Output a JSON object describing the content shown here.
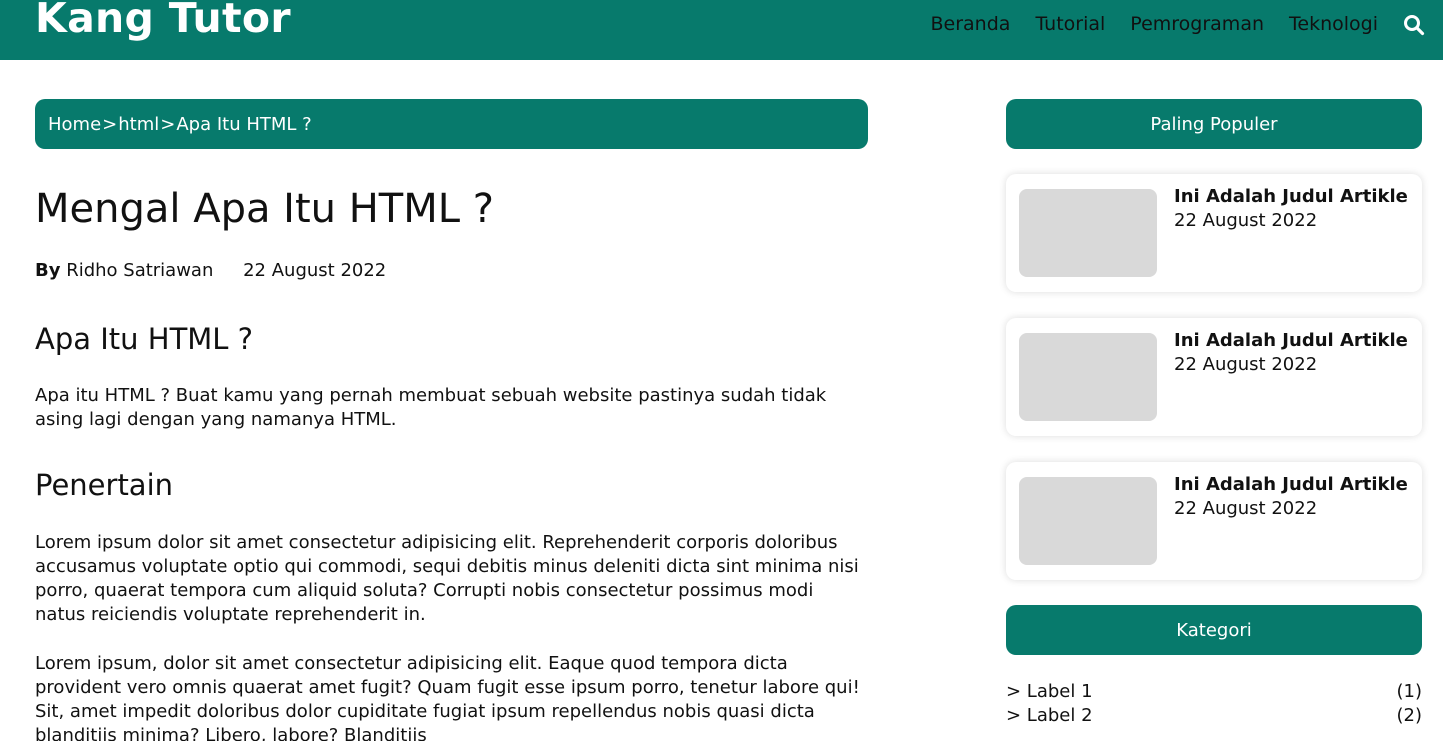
{
  "header": {
    "brand": "Kang Tutor",
    "nav": [
      "Beranda",
      "Tutorial",
      "Pemrograman",
      "Teknologi"
    ],
    "search_icon": "search-icon"
  },
  "breadcrumb": {
    "items": [
      "Home",
      "html",
      "Apa Itu HTML ?"
    ],
    "separator": ">"
  },
  "article": {
    "title": "Mengal Apa Itu HTML ?",
    "by_label": "By",
    "author": "Ridho Satriawan",
    "date": "22 August 2022",
    "section1_heading": "Apa Itu HTML ?",
    "section1_text": "Apa itu HTML ? Buat kamu yang pernah membuat sebuah website pastinya sudah tidak asing lagi dengan yang namanya HTML.",
    "section2_heading": "Penertain",
    "section2_text1": "Lorem ipsum dolor sit amet consectetur adipisicing elit. Reprehenderit corporis doloribus accusamus voluptate optio qui commodi, sequi debitis minus deleniti dicta sint minima nisi porro, quaerat tempora cum aliquid soluta? Corrupti nobis consectetur possimus modi natus reiciendis voluptate reprehenderit in.",
    "section2_text2": "Lorem ipsum, dolor sit amet consectetur adipisicing elit. Eaque quod tempora dicta provident vero omnis quaerat amet fugit? Quam fugit esse ipsum porro, tenetur labore qui! Sit, amet impedit doloribus dolor cupiditate fugiat ipsum repellendus nobis quasi dicta blanditiis minima? Libero, labore? Blanditiis"
  },
  "sidebar": {
    "popular_heading": "Paling Populer",
    "popular": [
      {
        "title": "Ini Adalah Judul Artikle",
        "date": "22 August 2022"
      },
      {
        "title": "Ini Adalah Judul Artikle",
        "date": "22 August 2022"
      },
      {
        "title": "Ini Adalah Judul Artikle",
        "date": "22 August 2022"
      }
    ],
    "category_heading": "Kategori",
    "categories": [
      {
        "label": "> Label 1",
        "count": "(1)"
      },
      {
        "label": "> Label 2",
        "count": "(2)"
      }
    ]
  },
  "colors": {
    "accent": "#077a6c",
    "thumb_placeholder": "#d9d9d9"
  }
}
